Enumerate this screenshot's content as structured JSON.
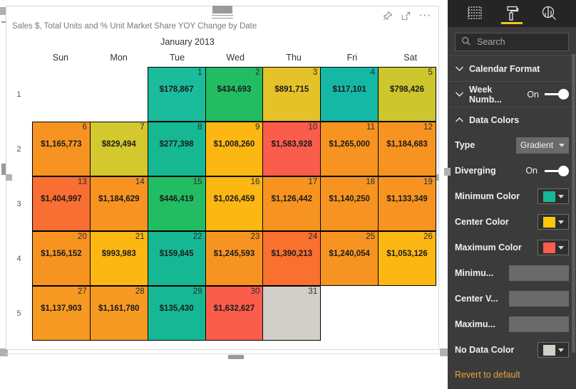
{
  "visual": {
    "title": "Sales $, Total Units and % Unit Market Share YOY Change by Date",
    "month_label": "January 2013",
    "icons": {
      "pin": "pin-icon",
      "focus": "focus-mode-icon",
      "more": "more-options-icon"
    },
    "weekdays": [
      "Sun",
      "Mon",
      "Tue",
      "Wed",
      "Thu",
      "Fri",
      "Sat"
    ],
    "week_numbers": [
      "1",
      "2",
      "3",
      "4",
      "5"
    ],
    "weeks": [
      [
        {
          "day": "",
          "value": "",
          "color": "",
          "empty": true
        },
        {
          "day": "",
          "value": "",
          "color": "",
          "empty": true
        },
        {
          "day": "1",
          "value": "$178,867",
          "color": "#1abc9c"
        },
        {
          "day": "2",
          "value": "$434,693",
          "color": "#22bd63"
        },
        {
          "day": "3",
          "value": "$891,715",
          "color": "#e6c229"
        },
        {
          "day": "4",
          "value": "$117,101",
          "color": "#15b7a5"
        },
        {
          "day": "5",
          "value": "$798,426",
          "color": "#cdc62e"
        }
      ],
      [
        {
          "day": "6",
          "value": "$1,165,773",
          "color": "#f79421"
        },
        {
          "day": "7",
          "value": "$829,494",
          "color": "#d4c82f"
        },
        {
          "day": "8",
          "value": "$277,398",
          "color": "#16b894"
        },
        {
          "day": "9",
          "value": "$1,008,260",
          "color": "#fcb713"
        },
        {
          "day": "10",
          "value": "$1,583,928",
          "color": "#fb5d4d"
        },
        {
          "day": "11",
          "value": "$1,265,000",
          "color": "#f79421"
        },
        {
          "day": "12",
          "value": "$1,184,683",
          "color": "#f79421"
        }
      ],
      [
        {
          "day": "13",
          "value": "$1,404,997",
          "color": "#f96e32"
        },
        {
          "day": "14",
          "value": "$1,184,629",
          "color": "#f79421"
        },
        {
          "day": "15",
          "value": "$446,419",
          "color": "#22bd63"
        },
        {
          "day": "16",
          "value": "$1,026,459",
          "color": "#fcb713"
        },
        {
          "day": "17",
          "value": "$1,126,442",
          "color": "#f79421"
        },
        {
          "day": "18",
          "value": "$1,140,250",
          "color": "#f79421"
        },
        {
          "day": "19",
          "value": "$1,133,349",
          "color": "#f79421"
        }
      ],
      [
        {
          "day": "20",
          "value": "$1,156,152",
          "color": "#f79421"
        },
        {
          "day": "21",
          "value": "$993,983",
          "color": "#fcb713"
        },
        {
          "day": "22",
          "value": "$159,845",
          "color": "#16b894"
        },
        {
          "day": "23",
          "value": "$1,245,593",
          "color": "#f79421"
        },
        {
          "day": "24",
          "value": "$1,390,213",
          "color": "#f9702f"
        },
        {
          "day": "25",
          "value": "$1,240,054",
          "color": "#f79421"
        },
        {
          "day": "26",
          "value": "$1,053,126",
          "color": "#fcb713"
        }
      ],
      [
        {
          "day": "27",
          "value": "$1,137,903",
          "color": "#f79a22"
        },
        {
          "day": "28",
          "value": "$1,161,780",
          "color": "#f79a22"
        },
        {
          "day": "29",
          "value": "$135,430",
          "color": "#16b894"
        },
        {
          "day": "30",
          "value": "$1,632,627",
          "color": "#fb5d4d"
        },
        {
          "day": "31",
          "value": "",
          "color": "#d2cec8"
        },
        {
          "day": "",
          "value": "",
          "color": "",
          "empty": true
        },
        {
          "day": "",
          "value": "",
          "color": "",
          "empty": true
        }
      ]
    ]
  },
  "panel": {
    "tabs": [
      {
        "name": "fields-tab",
        "icon": "fields-table-icon",
        "active": false
      },
      {
        "name": "format-tab",
        "icon": "paint-roller-icon",
        "active": true
      },
      {
        "name": "analytics-tab",
        "icon": "analytics-magnifier-icon",
        "active": false
      }
    ],
    "search": {
      "placeholder": "Search",
      "value": ""
    },
    "sections": [
      {
        "title": "Calendar Format",
        "expanded": false,
        "toggle": null
      },
      {
        "title": "Week Numb...",
        "expanded": false,
        "toggle": "On"
      },
      {
        "title": "Data Colors",
        "expanded": true,
        "toggle": null
      }
    ],
    "controls": {
      "type_label": "Type",
      "type_value": "Gradient",
      "diverging_label": "Diverging",
      "diverging_value": "On",
      "minimum_color_label": "Minimum Color",
      "minimum_color": "#17b897",
      "center_color_label": "Center Color",
      "center_color": "#fcc80c",
      "maximum_color_label": "Maximum Color",
      "maximum_color": "#fb5d4d",
      "minimum_value_label": "Minimu...",
      "minimum_value": "",
      "center_value_label": "Center V...",
      "center_value": "",
      "maximum_value_label": "Maximu...",
      "maximum_value": "",
      "no_data_color_label": "No Data Color",
      "no_data_color": "#d2cec8",
      "revert_label": "Revert to default",
      "revert_color": "#e8a33d"
    }
  }
}
